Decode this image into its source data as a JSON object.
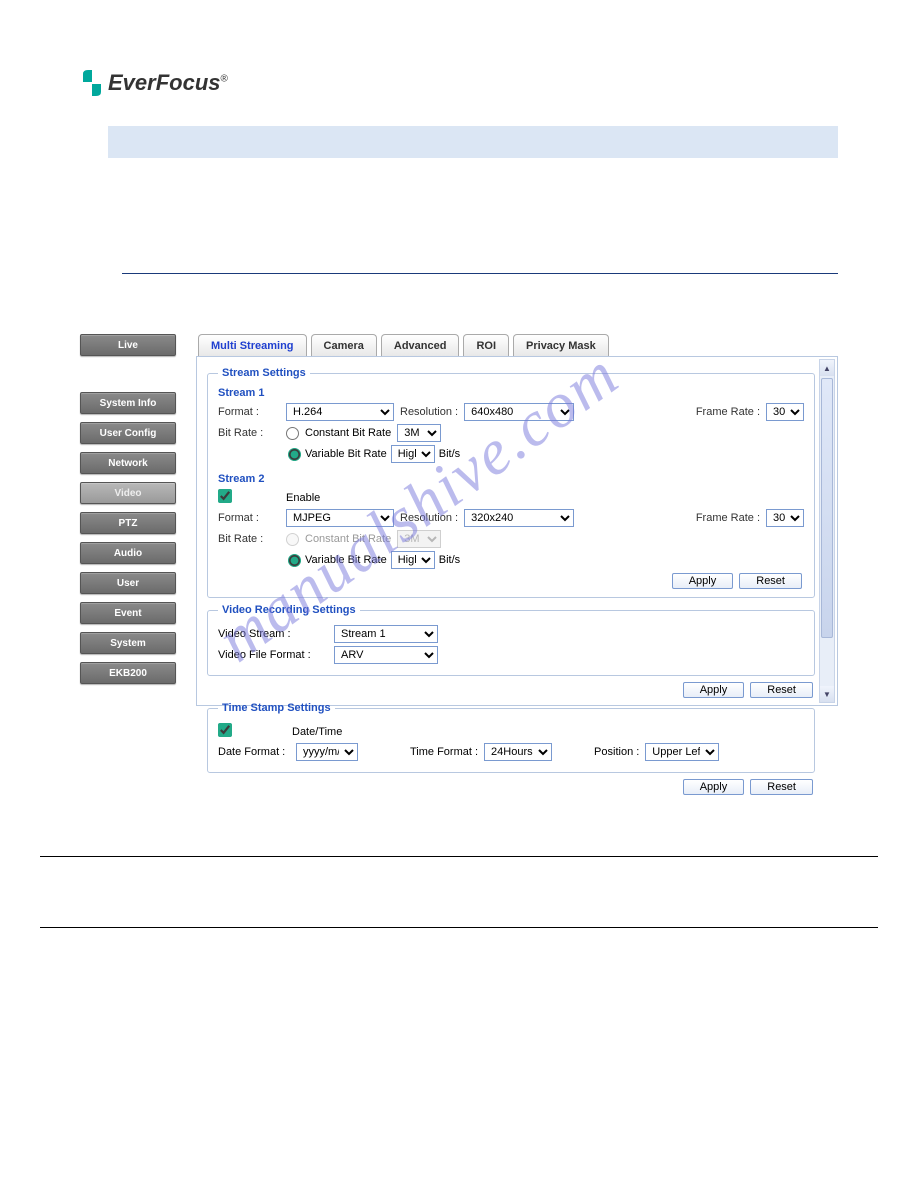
{
  "logo": {
    "brand": "EverFocus",
    "reg": "®"
  },
  "sidebar": {
    "items": [
      "Live",
      "System Info",
      "User Config",
      "Network",
      "Video",
      "PTZ",
      "Audio",
      "User",
      "Event",
      "System",
      "EKB200"
    ],
    "active": "Video"
  },
  "tabs": {
    "items": [
      "Multi Streaming",
      "Camera",
      "Advanced",
      "ROI",
      "Privacy Mask"
    ],
    "active": "Multi Streaming"
  },
  "stream_settings": {
    "legend": "Stream Settings",
    "stream1": {
      "heading": "Stream 1",
      "format_label": "Format :",
      "format": "H.264",
      "resolution_label": "Resolution :",
      "resolution": "640x480",
      "frame_rate_label": "Frame Rate :",
      "frame_rate": "30",
      "bitrate_label": "Bit Rate :",
      "cbr_label": "Constant Bit Rate",
      "cbr_value": "3M",
      "vbr_label": "Variable Bit Rate",
      "vbr_value": "High",
      "vbr_suffix": "Bit/s",
      "mode": "vbr"
    },
    "stream2": {
      "heading": "Stream 2",
      "enable_label": "Enable",
      "enabled": true,
      "format_label": "Format :",
      "format": "MJPEG",
      "resolution_label": "Resolution :",
      "resolution": "320x240",
      "frame_rate_label": "Frame Rate :",
      "frame_rate": "30",
      "bitrate_label": "Bit Rate :",
      "cbr_label": "Constant Bit Rate",
      "cbr_value": "3M",
      "vbr_label": "Variable Bit Rate",
      "vbr_value": "High",
      "vbr_suffix": "Bit/s",
      "mode": "vbr"
    },
    "apply": "Apply",
    "reset": "Reset"
  },
  "video_recording": {
    "legend": "Video Recording Settings",
    "stream_label": "Video Stream :",
    "stream": "Stream 1",
    "file_format_label": "Video File Format :",
    "file_format": "ARV",
    "apply": "Apply",
    "reset": "Reset"
  },
  "time_stamp": {
    "legend": "Time Stamp Settings",
    "enabled": true,
    "enable_label": "Date/Time",
    "date_format_label": "Date Format :",
    "date_format": "yyyy/m/d",
    "time_format_label": "Time Format :",
    "time_format": "24Hours",
    "position_label": "Position :",
    "position": "Upper Left",
    "apply": "Apply",
    "reset": "Reset"
  },
  "watermark": "manualshive.com"
}
